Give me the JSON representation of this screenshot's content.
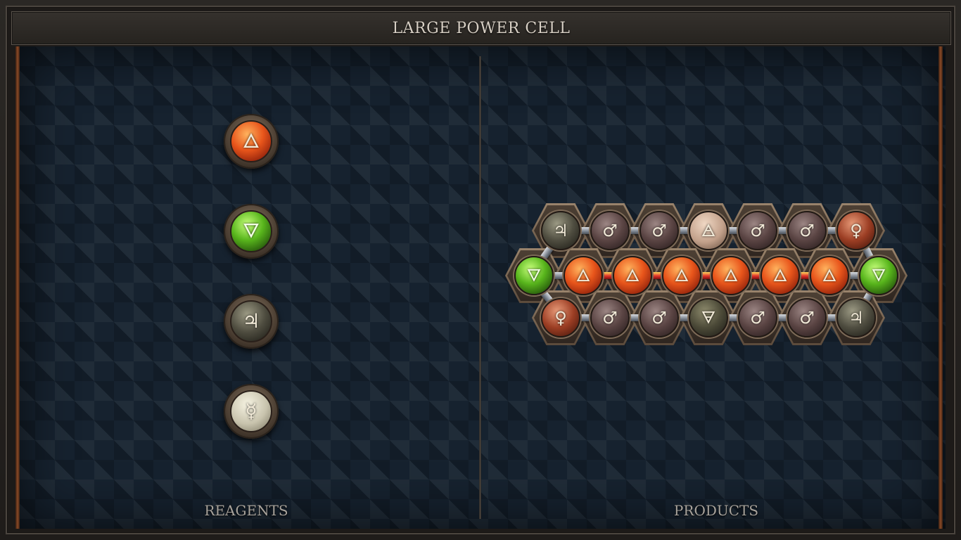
{
  "title": "LARGE POWER CELL",
  "sections": {
    "reagents_label": "REAGENTS",
    "products_label": "PRODUCTS"
  },
  "reagents": [
    {
      "element": "fire",
      "glyph": "🜂",
      "icon": "fire-element-icon"
    },
    {
      "element": "water",
      "glyph": "🜄",
      "icon": "water-element-icon"
    },
    {
      "element": "tin",
      "glyph": "♃",
      "icon": "tin-element-icon"
    },
    {
      "element": "quicksilver",
      "glyph": "☿",
      "icon": "quicksilver-element-icon"
    }
  ],
  "product": {
    "top_row": [
      {
        "element": "tin",
        "glyph": "♃"
      },
      {
        "element": "iron",
        "glyph": "♂"
      },
      {
        "element": "iron",
        "glyph": "♂"
      },
      {
        "element": "earth",
        "glyph": "🜁"
      },
      {
        "element": "iron",
        "glyph": "♂"
      },
      {
        "element": "iron",
        "glyph": "♂"
      },
      {
        "element": "copper",
        "glyph": "♀"
      }
    ],
    "middle_row": [
      {
        "element": "water",
        "glyph": "🜄"
      },
      {
        "element": "fire",
        "glyph": "🜂"
      },
      {
        "element": "fire",
        "glyph": "🜂"
      },
      {
        "element": "fire",
        "glyph": "🜂"
      },
      {
        "element": "fire",
        "glyph": "🜂"
      },
      {
        "element": "fire",
        "glyph": "🜂"
      },
      {
        "element": "fire",
        "glyph": "🜂"
      },
      {
        "element": "water",
        "glyph": "🜄"
      }
    ],
    "bottom_row": [
      {
        "element": "copper",
        "glyph": "♀"
      },
      {
        "element": "iron",
        "glyph": "♂"
      },
      {
        "element": "iron",
        "glyph": "♂"
      },
      {
        "element": "lead",
        "glyph": "🜃"
      },
      {
        "element": "iron",
        "glyph": "♂"
      },
      {
        "element": "iron",
        "glyph": "♂"
      },
      {
        "element": "tin",
        "glyph": "♃"
      }
    ]
  }
}
